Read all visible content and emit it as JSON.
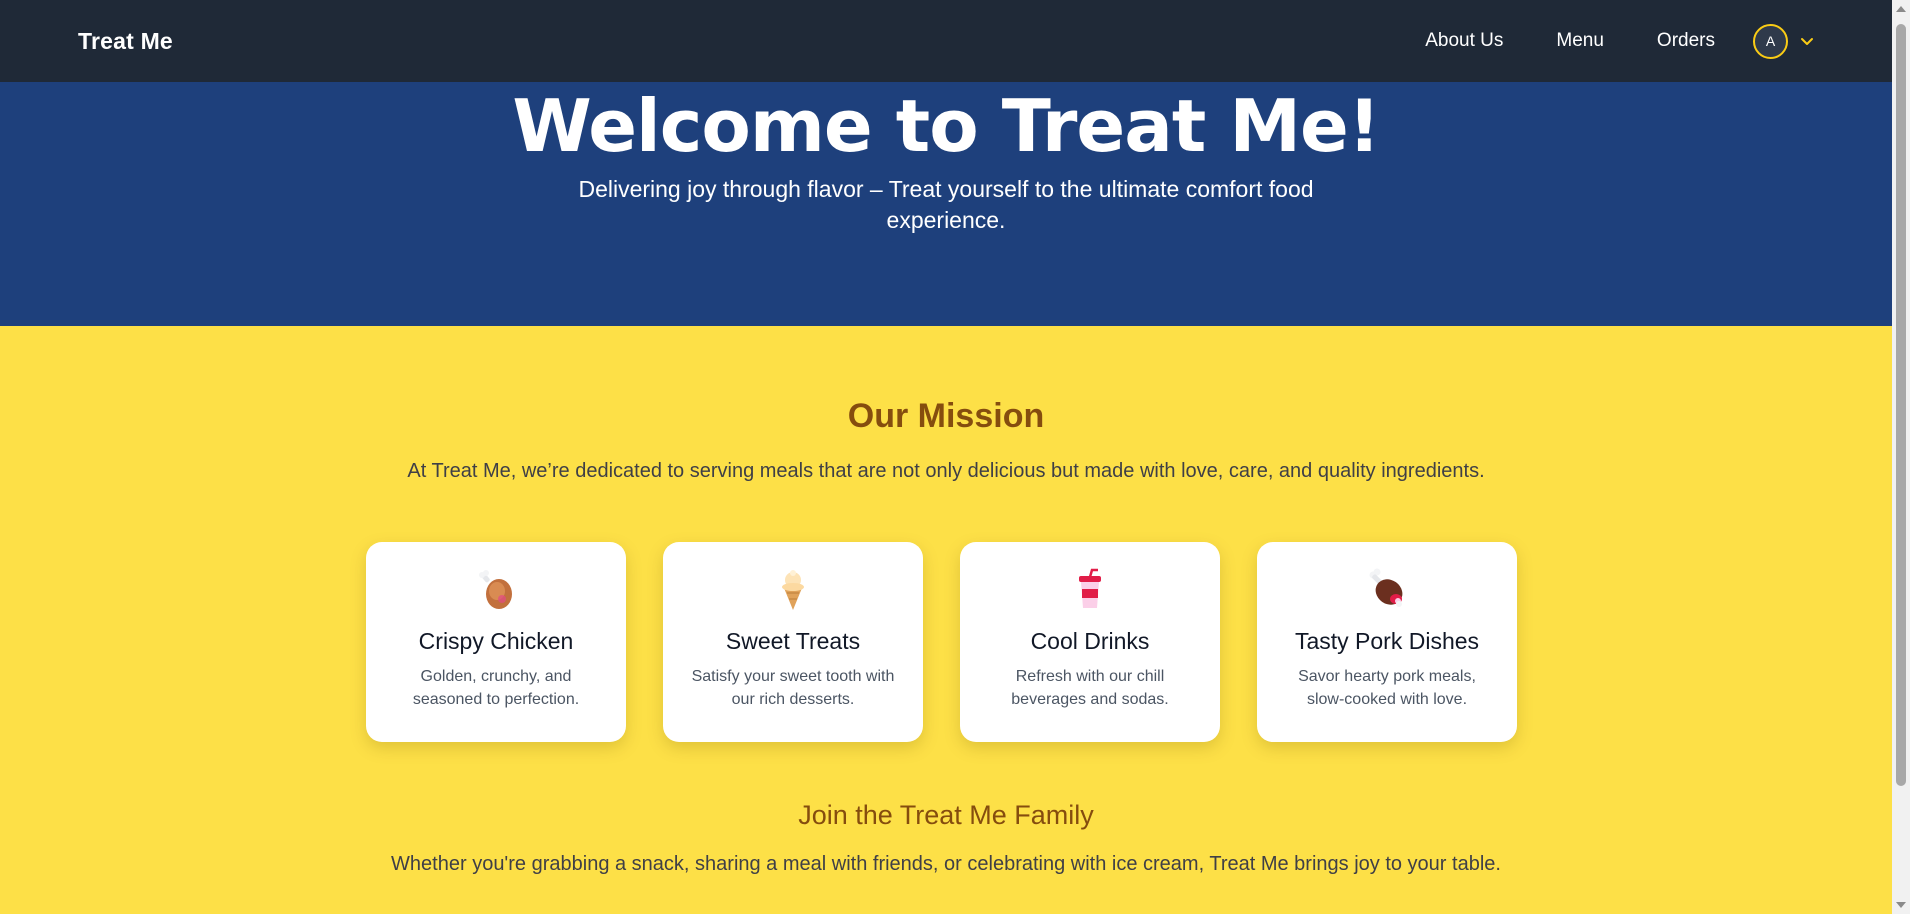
{
  "nav": {
    "brand": "Treat Me",
    "links": [
      "About Us",
      "Menu",
      "Orders"
    ],
    "avatar_initial": "A"
  },
  "hero": {
    "title": "Welcome to Treat Me!",
    "subtitle": "Delivering joy through flavor – Treat yourself to the ultimate comfort food experience."
  },
  "mission": {
    "title": "Our Mission",
    "text": "At Treat Me, we’re dedicated to serving meals that are not only delicious but made with love, care, and quality ingredients."
  },
  "cards": [
    {
      "icon": "chicken-leg-icon",
      "title": "Crispy Chicken",
      "desc": "Golden, crunchy, and seasoned to perfection."
    },
    {
      "icon": "ice-cream-icon",
      "title": "Sweet Treats",
      "desc": "Satisfy your sweet tooth with our rich desserts."
    },
    {
      "icon": "soda-cup-icon",
      "title": "Cool Drinks",
      "desc": "Refresh with our chill beverages and sodas."
    },
    {
      "icon": "pork-meat-icon",
      "title": "Tasty Pork Dishes",
      "desc": "Savor hearty pork meals, slow-cooked with love."
    }
  ],
  "family": {
    "title": "Join the Treat Me Family",
    "text": "Whether you're grabbing a snack, sharing a meal with friends, or celebrating with ice cream, Treat Me brings joy to your table."
  },
  "colors": {
    "nav_bg": "#1f2937",
    "hero_bg": "#1e407c",
    "page_bg": "#fde047",
    "heading_brown": "#854d0e",
    "avatar_ring": "#facc15"
  }
}
